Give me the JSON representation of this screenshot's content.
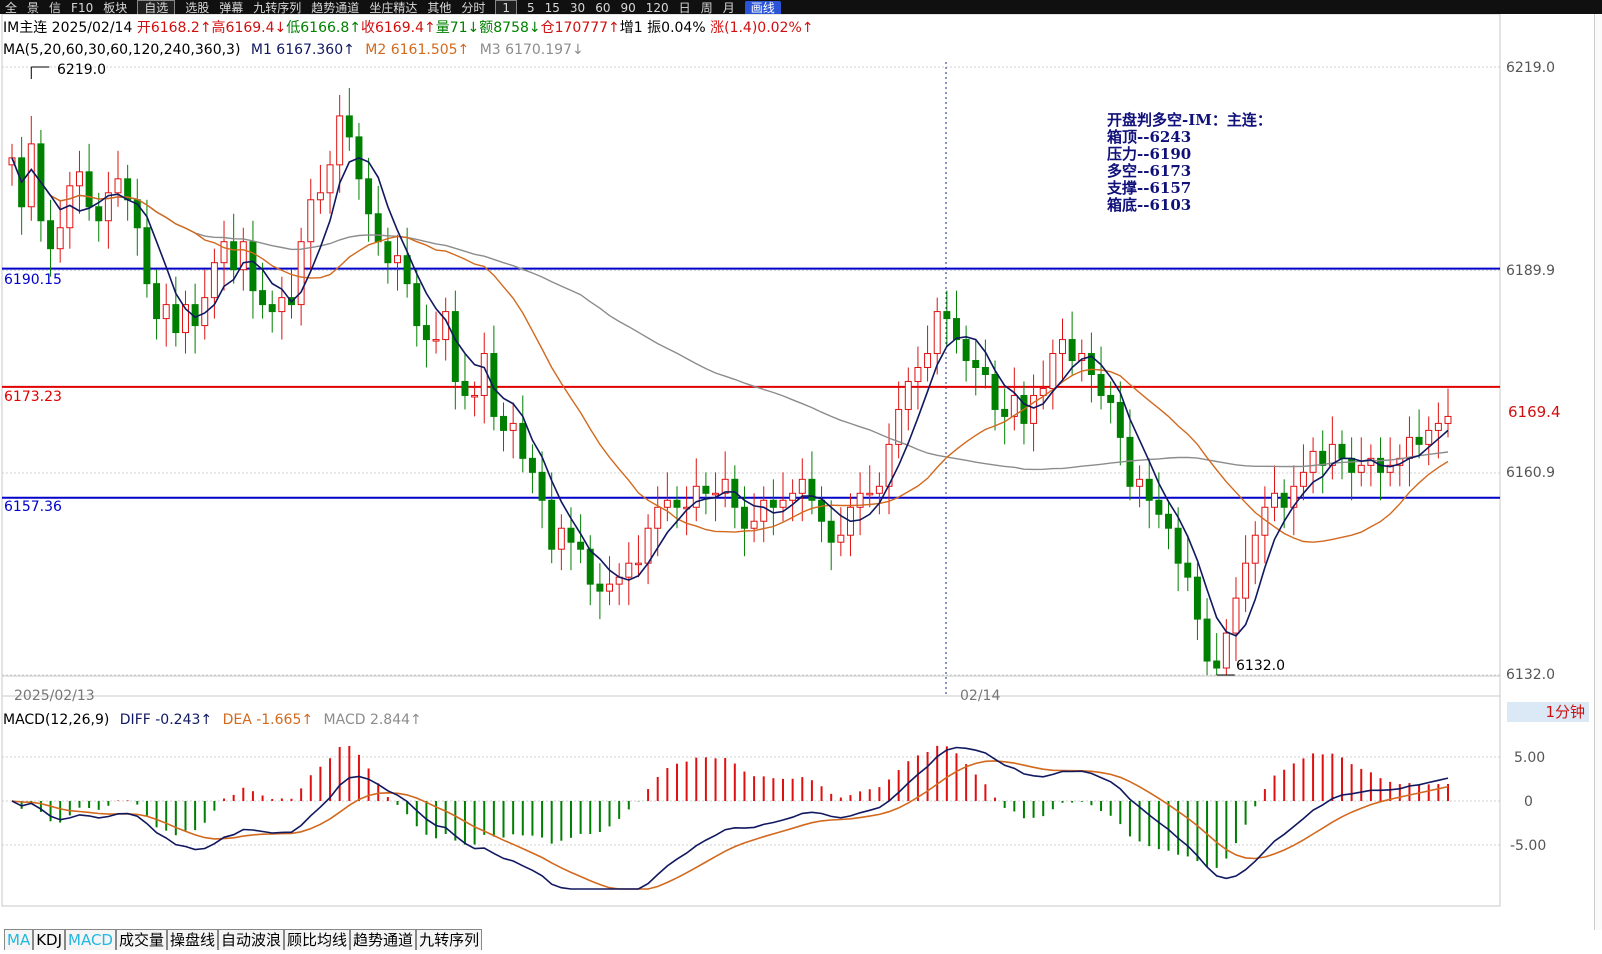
{
  "toolbar": {
    "items": [
      "全",
      "景",
      "信",
      "F10",
      "板块",
      "自选",
      "选股",
      "弹幕",
      "九转序列",
      "趋势通道",
      "坐庄精达",
      "其他",
      "分时",
      "1",
      "5",
      "15",
      "30",
      "60",
      "90",
      "120",
      "日",
      "周",
      "月",
      "画线"
    ]
  },
  "header": {
    "symbol": "IM主连",
    "date": "2025/02/14",
    "open": "开6168.2↑",
    "high": "高6169.4↓",
    "low": "低6166.8↑",
    "close": "收6169.4↑",
    "volume": "量71↓",
    "amount": "额8758↓",
    "position": "仓170777↑",
    "increase": "增1",
    "amplitude": "振0.04%",
    "change": "涨(1.4)0.02%↑"
  },
  "ma_line": {
    "label": "MA(5,20,60,30,60,120,240,360,3)",
    "m1": "M1 6167.360↑",
    "m2": "M2 6161.505↑",
    "m3": "M3 6170.197↓"
  },
  "annotation": {
    "title": "开盘判多空-IM：主连：",
    "lines": [
      "箱顶--6243",
      "压力--6190",
      "多空--6173",
      "支撑--6157",
      "箱底--6103"
    ]
  },
  "levels": {
    "upper_blue": "6190.15",
    "red": "6173.23",
    "lower_blue": "6157.36"
  },
  "markers": {
    "high": "6219.0",
    "low": "6132.0",
    "last": "6169.4"
  },
  "y_axis": [
    "6219.0",
    "6189.9",
    "6160.9",
    "6132.0"
  ],
  "x_axis": {
    "left_date": "2025/02/13",
    "mid_date": "02/14"
  },
  "period": "1分钟",
  "macd": {
    "label": "MACD(12,26,9)",
    "diff": "DIFF -0.243↑",
    "dea": "DEA -1.665↑",
    "macd": "MACD 2.844↑",
    "y_axis": [
      "5.00",
      "0",
      "-5.00"
    ]
  },
  "bottom_tabs": [
    "MA",
    "KDJ",
    "MACD",
    "成交量",
    "操盘线",
    "自动波浪",
    "顾比均线",
    "趋势通道",
    "九转序列"
  ],
  "colors": {
    "up": "#e01010",
    "down": "#008000",
    "ma1": "#101860",
    "ma2": "#d2691e",
    "ma3": "#8c8c8c",
    "level_blue": "#0000c8",
    "level_red": "#e00000"
  },
  "chart_data": {
    "type": "candlestick",
    "x_range": [
      "2025/02/13",
      "02/14"
    ],
    "ylim": [
      6132.0,
      6219.0
    ],
    "closes": [
      6206,
      6199,
      6208,
      6197,
      6193,
      6196,
      6202,
      6204,
      6199,
      6197,
      6201,
      6203,
      6200,
      6196,
      6188,
      6183,
      6185,
      6181,
      6185,
      6182,
      6186,
      6191,
      6194,
      6190,
      6194,
      6187,
      6185,
      6184,
      6186,
      6185,
      6194,
      6200,
      6201,
      6205,
      6212,
      6209,
      6203,
      6198,
      6194,
      6191,
      6192,
      6188,
      6182,
      6180,
      6180,
      6184,
      6174,
      6172,
      6172,
      6178,
      6169,
      6167,
      6168,
      6163,
      6161,
      6157,
      6150,
      6153,
      6151,
      6150,
      6145,
      6144,
      6145,
      6146,
      6148,
      6148,
      6153,
      6156,
      6157,
      6156,
      6156,
      6159,
      6158,
      6158,
      6160,
      6156,
      6153,
      6154,
      6157,
      6156,
      6157,
      6158,
      6160,
      6157,
      6154,
      6151,
      6152,
      6156,
      6158,
      6158,
      6159,
      6165,
      6170,
      6174,
      6176,
      6178,
      6184,
      6183,
      6180,
      6177,
      6176,
      6175,
      6170,
      6169,
      6172,
      6168,
      6172,
      6173,
      6178,
      6180,
      6177,
      6178,
      6175,
      6172,
      6171,
      6166,
      6159,
      6160,
      6157,
      6155,
      6153,
      6148,
      6146,
      6140,
      6134,
      6133,
      6138,
      6143,
      6148,
      6152,
      6156,
      6158,
      6156,
      6159,
      6161,
      6164,
      6162,
      6165,
      6163,
      6161,
      6162,
      6163,
      6161,
      6162,
      6163,
      6166,
      6165,
      6167,
      6168,
      6169
    ]
  }
}
